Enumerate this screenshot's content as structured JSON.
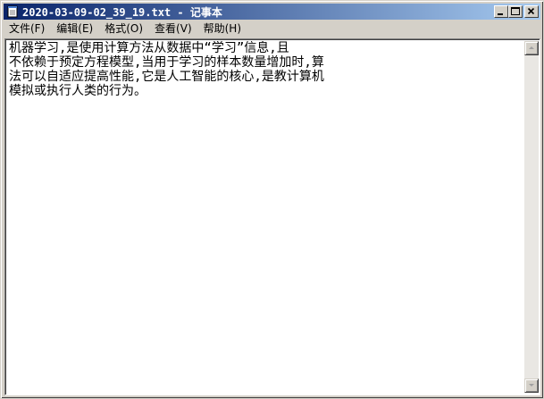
{
  "window": {
    "title": "2020-03-09-02_39_19.txt - 记事本"
  },
  "menu": [
    {
      "label": "文件(F)"
    },
    {
      "label": "编辑(E)"
    },
    {
      "label": "格式(O)"
    },
    {
      "label": "查看(V)"
    },
    {
      "label": "帮助(H)"
    }
  ],
  "document": {
    "lines": [
      "机器学习,是使用计算方法从数据中“学习”信息,且",
      "不依赖于预定方程模型,当用于学习的样本数量增加时,算",
      "法可以自适应提高性能,它是人工智能的核心,是教计算机",
      "模拟或执行人类的行为。"
    ]
  },
  "colors": {
    "title_active_start": "#0a246a",
    "title_active_end": "#a6caf0",
    "face": "#d4d0c8"
  },
  "icons": {
    "app": "notepad-icon",
    "minimize": "minimize-icon",
    "maximize": "maximize-icon",
    "close": "close-icon",
    "scroll_up": "arrow-up-icon",
    "scroll_down": "arrow-down-icon"
  }
}
